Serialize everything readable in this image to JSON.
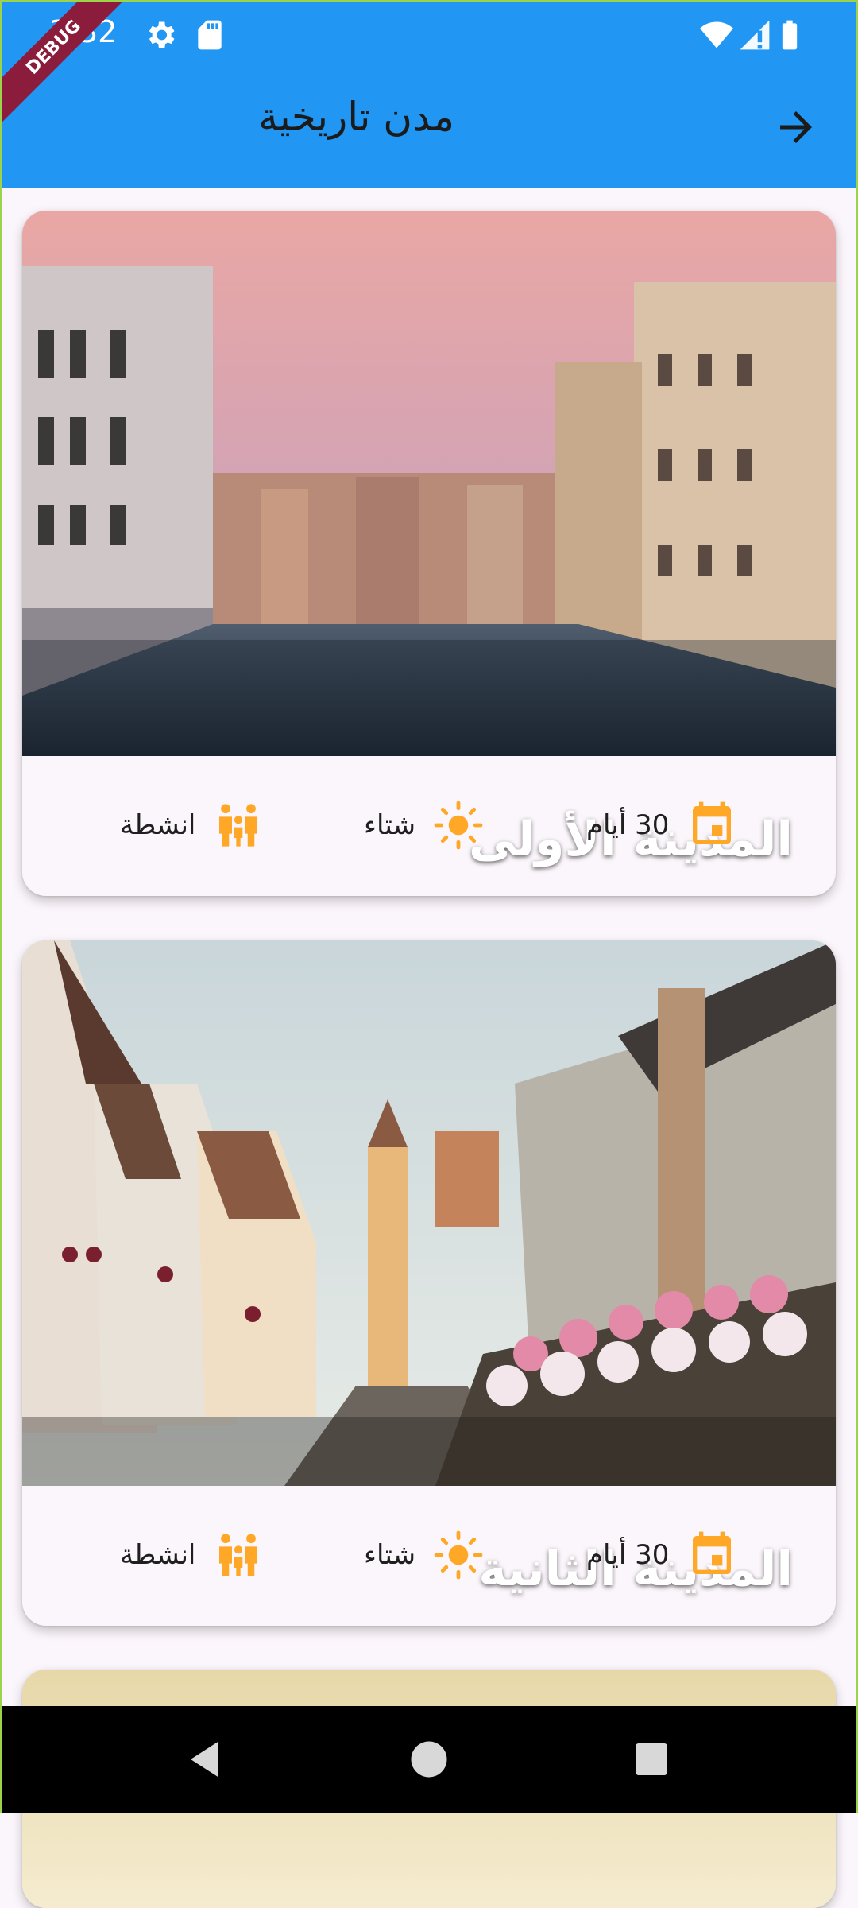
{
  "status_bar": {
    "time": "3:32",
    "left_icons": [
      "gear-icon",
      "sd-card-icon"
    ],
    "right_icons": [
      "wifi-icon",
      "signal-icon",
      "battery-icon"
    ],
    "debug_banner": "DEBUG"
  },
  "app_bar": {
    "title": "مدن تاريخية",
    "action_icon": "arrow-right-icon",
    "color": "#2196f3"
  },
  "cards": [
    {
      "title": "المدينة الأولى",
      "image": "venice-canal-sunset",
      "duration": "30 أيام",
      "season": "شتاء",
      "activities": "انشطة"
    },
    {
      "title": "المدينة الثانية",
      "image": "half-timbered-street",
      "duration": "30 أيام",
      "season": "شتاء",
      "activities": "انشطة"
    }
  ],
  "accent_color": "#ffa726",
  "nav_bar": {
    "buttons": [
      "back-triangle-icon",
      "home-circle-icon",
      "recents-square-icon"
    ]
  }
}
